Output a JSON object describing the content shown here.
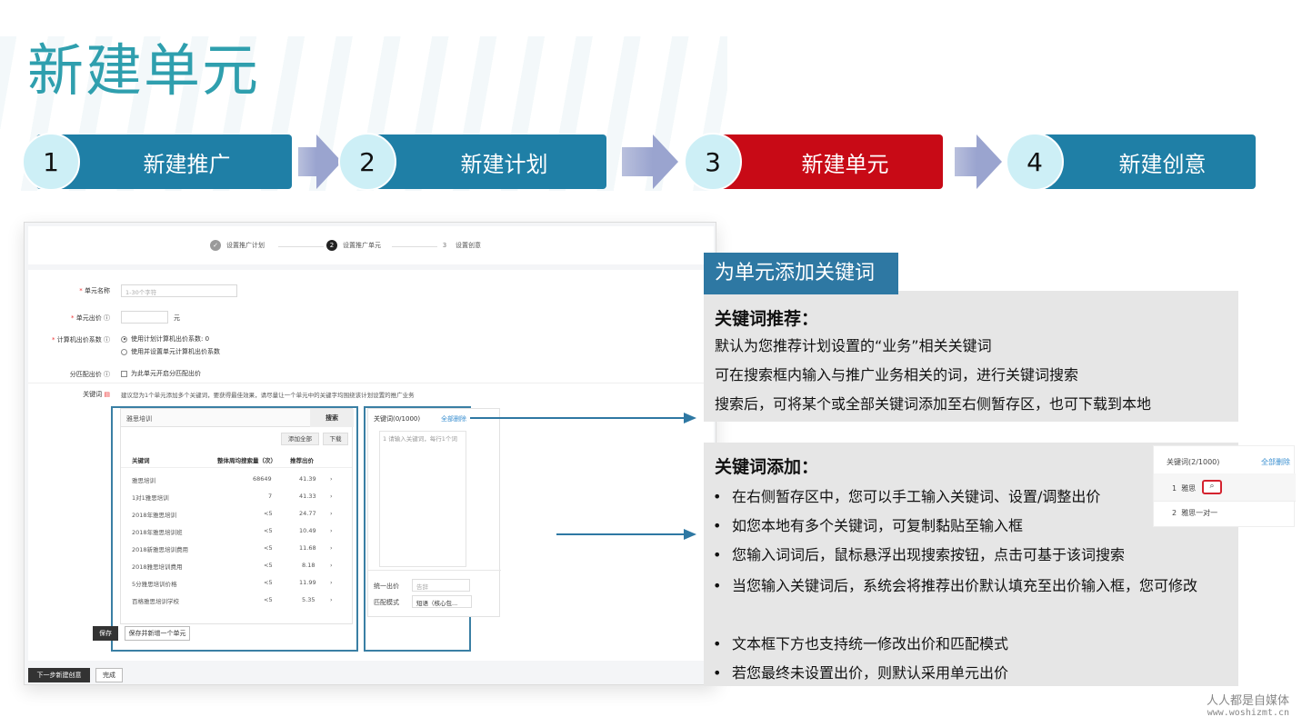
{
  "title": "新建单元",
  "steps": [
    {
      "num": "1",
      "label": "新建推广",
      "color": "#1f7fa6"
    },
    {
      "num": "2",
      "label": "新建计划",
      "color": "#1f7fa6"
    },
    {
      "num": "3",
      "label": "新建单元",
      "color": "#c80a16"
    },
    {
      "num": "4",
      "label": "新建创意",
      "color": "#1f7fa6"
    }
  ],
  "screenshot": {
    "progress": [
      {
        "num": "✓",
        "label": "设置推广计划"
      },
      {
        "num": "2",
        "label": "设置推广单元"
      },
      {
        "num": "3",
        "label": "设置创意"
      }
    ],
    "form": {
      "unit_name_label": "单元名称",
      "unit_name_placeholder": "1-30个字符",
      "unit_bid_label": "单元出价",
      "unit_bid_unit": "元",
      "pc_factor_label": "计算机出价系数",
      "pc_factor_option1": "使用计划计算机出价系数: 0",
      "pc_factor_option2": "使用并设置单元计算机出价系数",
      "match_bid_label": "分匹配出价",
      "match_bid_option": "为此单元开启分匹配出价",
      "keyword_label": "关键词",
      "keyword_tip": "建议您为1个单元添加多个关键词，要获得最佳效果，请尽量让一个单元中的关键字均围绕该计划设置的推广业务"
    },
    "search": {
      "value": "雅思培训",
      "search_button": "搜索",
      "add_all": "添加全部",
      "download": "下载",
      "headers": [
        "关键词",
        "整体周均搜索量（次）",
        "推荐出价"
      ],
      "rows": [
        [
          "雅思培训",
          "68649",
          "41.39"
        ],
        [
          "1对1雅思培训",
          "7",
          "41.33"
        ],
        [
          "2018年雅思培训",
          "<5",
          "24.77"
        ],
        [
          "2018年雅思培训班",
          "<5",
          "10.49"
        ],
        [
          "2018新雅思培训费用",
          "<5",
          "11.68"
        ],
        [
          "2018雅思培训费用",
          "<5",
          "8.18"
        ],
        [
          "5分雅思培训价格",
          "<5",
          "11.99"
        ],
        [
          "百格雅思培训学校",
          "<5",
          "5.35"
        ]
      ],
      "row_arrow": "›"
    },
    "staging": {
      "header": "关键词(0/1000)",
      "clear_all": "全部删除",
      "placeholder": "1  请输入关键词，每行1个词",
      "unified_bid_label": "统一出价",
      "unified_bid_placeholder": "告辞",
      "match_mode_label": "匹配模式",
      "match_mode_value": "短语（核心包..."
    },
    "buttons": {
      "save": "保存",
      "save_and_new": "保存并新增一个单元",
      "next": "下一步新建创意",
      "done": "完成"
    }
  },
  "annotation": {
    "tag": "为单元添加关键词",
    "recommend_heading": "关键词推荐：",
    "recommend_lines": [
      "默认为您推荐计划设置的“业务”相关关键词",
      "可在搜索框内输入与推广业务相关的词，进行关键词搜索",
      "搜索后，可将某个或全部关键词添加至右侧暂存区，也可下载到本地"
    ],
    "add_heading": "关键词添加：",
    "add_bullets": [
      "在右侧暂存区中，您可以手工输入关键词、设置/调整出价",
      "如您本地有多个关键词，可复制黏贴至输入框",
      "您输入词词后，鼠标悬浮出现搜索按钮，点击可基于该词搜索",
      "当您输入关键词后，系统会将推荐出价默认填充至出价输入框，您可修改",
      "文本框下方也支持统一修改出价和匹配模式",
      "若您最终未设置出价，则默认采用单元出价"
    ],
    "mini_panel": {
      "header": "关键词(2/1000)",
      "clear_all": "全部删除",
      "rows": [
        {
          "num": "1",
          "word": "雅思"
        },
        {
          "num": "2",
          "word": "雅思一对一"
        }
      ]
    }
  },
  "watermark": {
    "line1": "人人都是自媒体",
    "line2": "www.woshizmt.cn"
  }
}
